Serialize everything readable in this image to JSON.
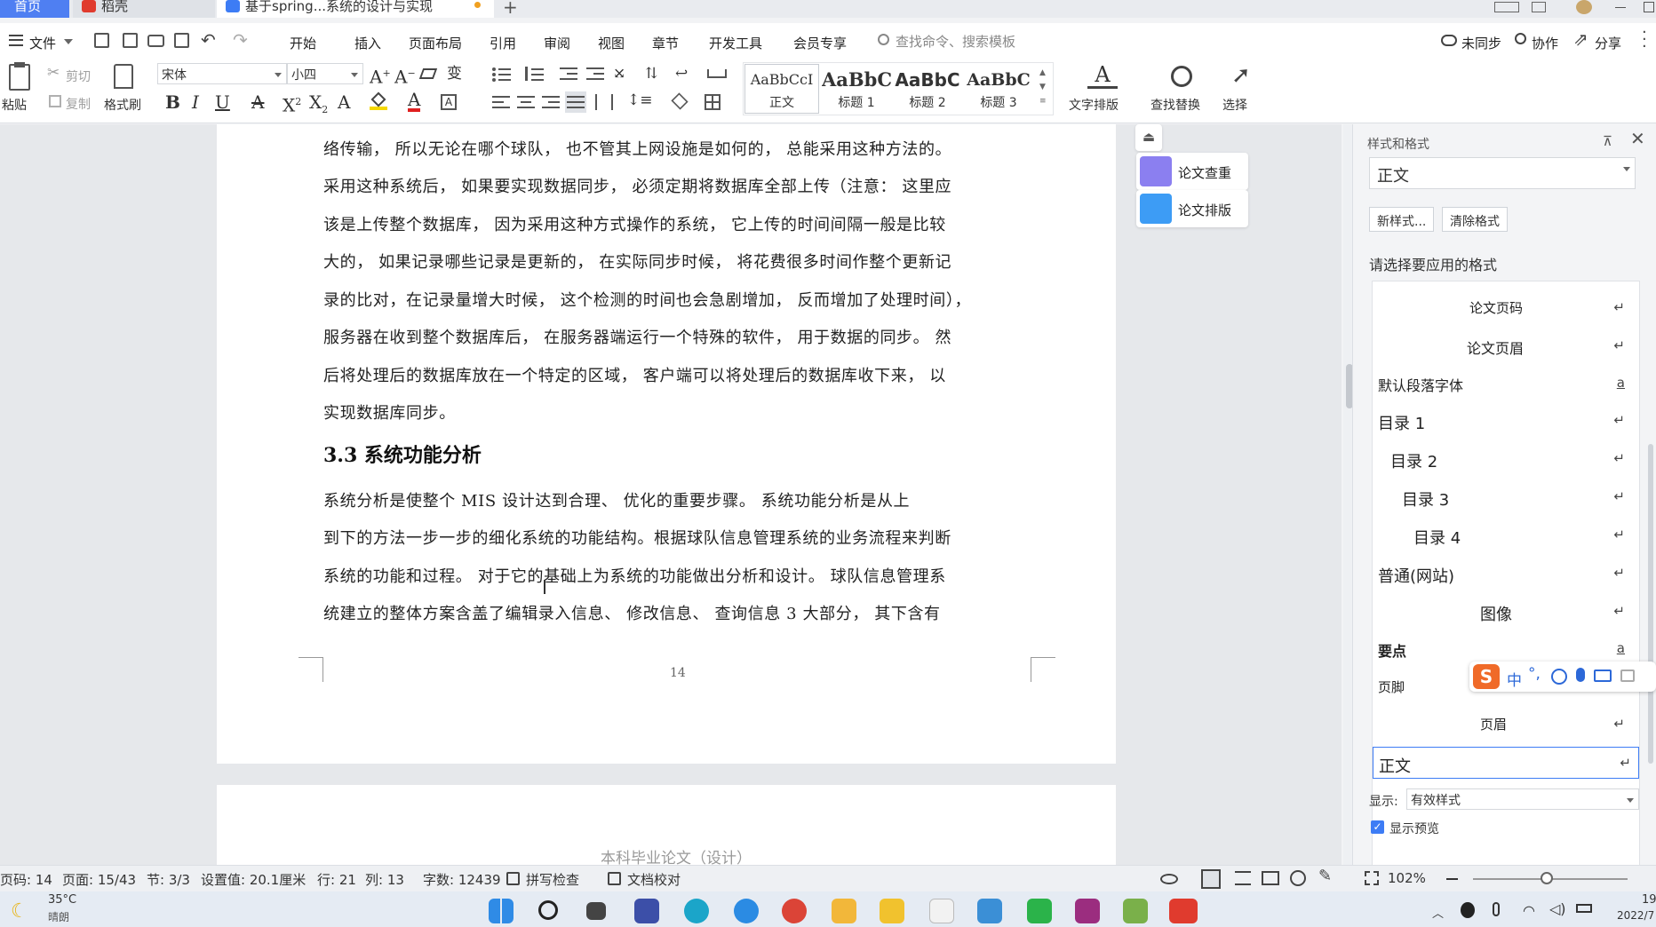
{
  "tabs": {
    "home": "首页",
    "daoke": "稻壳",
    "doc": "基于spring...系统的设计与实现"
  },
  "menubar": {
    "file": "文件",
    "items": [
      "开始",
      "插入",
      "页面布局",
      "引用",
      "审阅",
      "视图",
      "章节",
      "开发工具",
      "会员专享"
    ],
    "active": "开始",
    "search_placeholder": "查找命令、搜索模板",
    "sync": "未同步",
    "collab": "协作",
    "share": "分享"
  },
  "ribbon": {
    "paste": "粘贴",
    "cut": "剪切",
    "copy": "复制",
    "format_painter": "格式刷",
    "font_name": "宋体",
    "font_size": "小四",
    "styles": [
      {
        "preview": "AaBbCcI",
        "name": "正文"
      },
      {
        "preview": "AaBbC",
        "name": "标题 1"
      },
      {
        "preview": "AaBbC",
        "name": "标题 2"
      },
      {
        "preview": "AaBbC",
        "name": "标题 3"
      }
    ],
    "text_layout": "文字排版",
    "find_replace": "查找替换",
    "select": "选择"
  },
  "document": {
    "lines_top": [
      "络传输，  所以无论在哪个球队，  也不管其上网设施是如何的，  总能采用这种方法的。",
      "采用这种系统后，  如果要实现数据同步，  必须定期将数据库全部上传（注意：  这里应",
      "该是上传整个数据库，  因为采用这种方式操作的系统，  它上传的时间间隔一般是比较",
      "大的，  如果记录哪些记录是更新的，  在实际同步时候，  将花费很多时间作整个更新记",
      "录的比对，在记录量增大时候，  这个检测的时间也会急剧增加，  反而增加了处理时间），",
      "服务器在收到整个数据库后，  在服务器端运行一个特殊的软件，  用于数据的同步。  然",
      "后将处理后的数据库放在一个特定的区域，  客户端可以将处理后的数据库收下来，  以",
      "实现数据库同步。"
    ],
    "heading": "3.3  系统功能分析",
    "lines_bottom": [
      "    系统分析是使整个 MIS 设计达到合理、 优化的重要步骤。  系统功能分析是从上",
      "到下的方法一步一步的细化系统的功能结构。根据球队信息管理系统的业务流程来判断",
      "系统的功能和过程。  对于它的基础上为系统的功能做出分析和设计。  球队信息管理系",
      "统建立的整体方案含盖了编辑录入信息、  修改信息、  查询信息 3 大部分，  其下含有"
    ],
    "page_number": "14",
    "next_page_header": "本科毕业论文（设计）"
  },
  "side_tools": {
    "check": "论文查重",
    "layout": "论文排版"
  },
  "styles_pane": {
    "title": "样式和格式",
    "current_style": "正文",
    "new_style": "新样式...",
    "clear_format": "清除格式",
    "prompt": "请选择要应用的格式",
    "items": [
      {
        "label": "论文页码",
        "mark": "↵"
      },
      {
        "label": "论文页眉",
        "mark": "↵"
      },
      {
        "label": "默认段落字体",
        "mark": "a"
      },
      {
        "label": "目录 1",
        "mark": "↵"
      },
      {
        "label": "目录 2",
        "mark": "↵"
      },
      {
        "label": "目录 3",
        "mark": "↵"
      },
      {
        "label": "目录 4",
        "mark": "↵"
      },
      {
        "label": "普通(网站)",
        "mark": "↵"
      },
      {
        "label": "图像",
        "mark": "↵"
      },
      {
        "label": "要点",
        "mark": "a"
      },
      {
        "label": "页脚",
        "mark": "↵"
      },
      {
        "label": "页眉",
        "mark": "↵"
      },
      {
        "label": "正文",
        "mark": "↵"
      }
    ],
    "show_label": "显示:",
    "show_value": "有效样式",
    "preview_label": "显示预览"
  },
  "statusbar": {
    "page_num": "页码: 14",
    "page": "页面: 15/43",
    "section": "节: 3/3",
    "setting": "设置值: 20.1厘米",
    "row": "行: 21",
    "col": "列: 13",
    "words": "字数: 12439",
    "spell": "拼写检查",
    "proof": "文档校对",
    "zoom": "102%"
  },
  "taskbar": {
    "temp": "35°C",
    "weather": "晴朗",
    "time": "19",
    "date": "2022/7"
  },
  "ime": {
    "lang": "中"
  },
  "colors": {
    "accent": "#3d7cf5",
    "wps_red": "#e03b2e",
    "paper": "#ffffff"
  }
}
